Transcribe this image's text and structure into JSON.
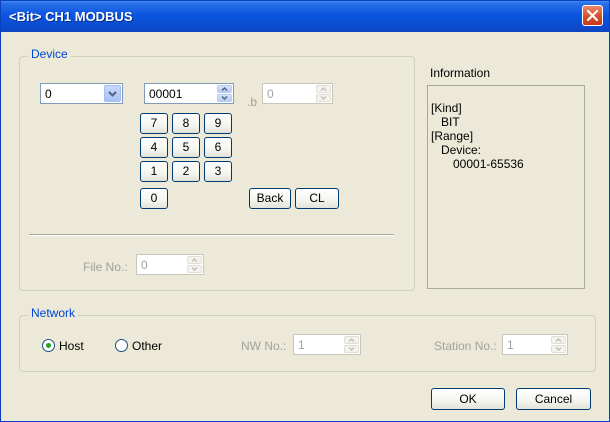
{
  "window": {
    "title": "<Bit> CH1 MODBUS"
  },
  "device": {
    "legend": "Device",
    "type_value": "0",
    "address_value": "00001",
    "bit_label": ".b",
    "bit_value": "0",
    "keypad": [
      "7",
      "8",
      "9",
      "4",
      "5",
      "6",
      "1",
      "2",
      "3",
      "0"
    ],
    "back_label": "Back",
    "clear_label": "CL",
    "file_label": "File No.:",
    "file_value": "0"
  },
  "information": {
    "heading": "Information",
    "lines": [
      "[Kind]",
      "BIT",
      "[Range]",
      "Device:",
      "00001-65536"
    ]
  },
  "network": {
    "legend": "Network",
    "host_label": "Host",
    "other_label": "Other",
    "selected": "Host",
    "nw_label": "NW No.:",
    "nw_value": "1",
    "station_label": "Station No.:",
    "station_value": "1"
  },
  "footer": {
    "ok_label": "OK",
    "cancel_label": "Cancel"
  },
  "colors": {
    "titlebar": "#0b4fd3",
    "dialog": "#ece9d8",
    "legend_text": "#0046d5",
    "close": "#d9532e"
  }
}
